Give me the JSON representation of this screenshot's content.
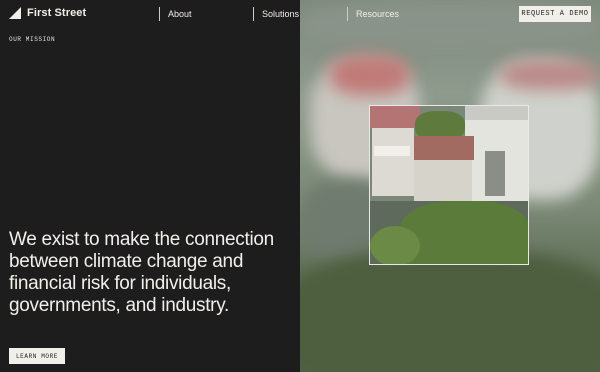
{
  "brand": {
    "name": "First Street",
    "icon": "first-street-logo-mark"
  },
  "nav": {
    "links": [
      {
        "label": "About"
      },
      {
        "label": "Solutions"
      },
      {
        "label": "Resources"
      }
    ],
    "cta_label": "REQUEST A DEMO"
  },
  "hero": {
    "eyebrow": "OUR MISSION",
    "headline": "We exist to make the connection between climate change and financial risk for individuals, governments, and industry.",
    "cta_label": "LEARN MORE"
  },
  "colors": {
    "background": "#1e1d1d",
    "text": "#f1efe9",
    "button_bg": "#f1efe9",
    "button_text": "#1e1d1d"
  }
}
